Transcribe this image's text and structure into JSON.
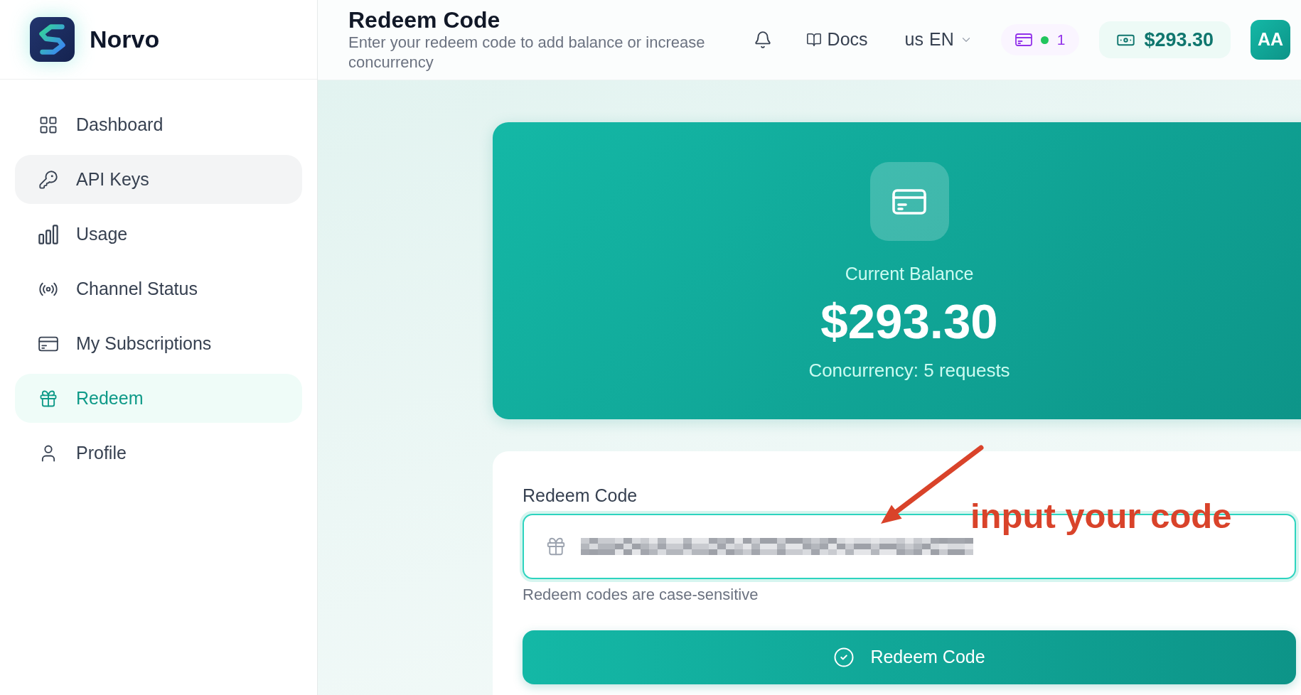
{
  "brand": {
    "name": "Norvo"
  },
  "sidebar": {
    "items": [
      {
        "label": "Dashboard",
        "selected": false,
        "highlighted": false
      },
      {
        "label": "API Keys",
        "selected": false,
        "highlighted": true
      },
      {
        "label": "Usage",
        "selected": false,
        "highlighted": false
      },
      {
        "label": "Channel Status",
        "selected": false,
        "highlighted": false
      },
      {
        "label": "My Subscriptions",
        "selected": false,
        "highlighted": false
      },
      {
        "label": "Redeem",
        "selected": true,
        "highlighted": false
      },
      {
        "label": "Profile",
        "selected": false,
        "highlighted": false
      }
    ]
  },
  "header": {
    "title": "Redeem Code",
    "subtitle": "Enter your redeem code to add balance or increase concurrency",
    "docs_link": "Docs",
    "language": {
      "flag": "us",
      "code": "EN"
    },
    "subscriptions_badge": {
      "count": "1"
    },
    "balance": "$293.30",
    "avatar": "AA"
  },
  "balance_card": {
    "label": "Current Balance",
    "amount": "$293.30",
    "concurrency": "Concurrency: 5 requests"
  },
  "redeem_form": {
    "label": "Redeem Code",
    "input": {
      "value_obscured": true
    },
    "hint": "Redeem codes are case-sensitive",
    "button": "Redeem Code"
  },
  "annotation": {
    "text": "input your code"
  }
}
